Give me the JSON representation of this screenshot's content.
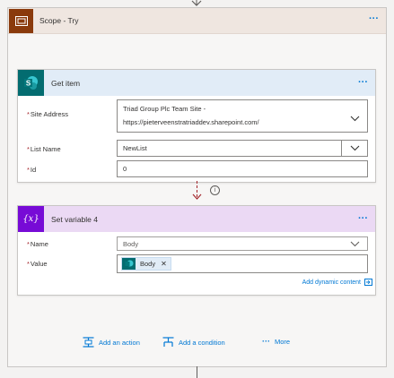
{
  "colors": {
    "scope_header_bg": "#efe6e0",
    "scope_icon_bg": "#8a3a0c",
    "sharepoint_header_bg": "#e1ecf7",
    "sharepoint_icon_bg": "#036c70",
    "variable_header_bg": "#ebd9f4",
    "variable_icon_bg": "#770bd6",
    "link": "#0078d4",
    "required": "#a4262c"
  },
  "scope": {
    "title": "Scope - Try",
    "icon": "scope-icon",
    "menu": "···"
  },
  "get_item": {
    "title": "Get item",
    "icon": "sharepoint-icon",
    "menu": "···",
    "fields": [
      {
        "label": "Site Address",
        "value_line1": "Triad Group Plc Team Site -",
        "value_line2": "https://pieterveenstratriaddev.sharepoint.com/"
      },
      {
        "label": "List Name",
        "value": "NewList"
      },
      {
        "label": "Id",
        "value": "0"
      }
    ]
  },
  "set_variable": {
    "title": "Set variable 4",
    "icon": "variable-icon",
    "icon_text": "{x}",
    "menu": "···",
    "fields": [
      {
        "label": "Name",
        "value": "Body"
      },
      {
        "label": "Value",
        "token": "Body"
      }
    ],
    "dynamic_content_link": "Add dynamic content"
  },
  "footer_actions": {
    "add_action": "Add an action",
    "add_condition": "Add a condition",
    "more": "More",
    "more_dots": "···"
  },
  "required_mark": "*",
  "info_glyph": "i"
}
